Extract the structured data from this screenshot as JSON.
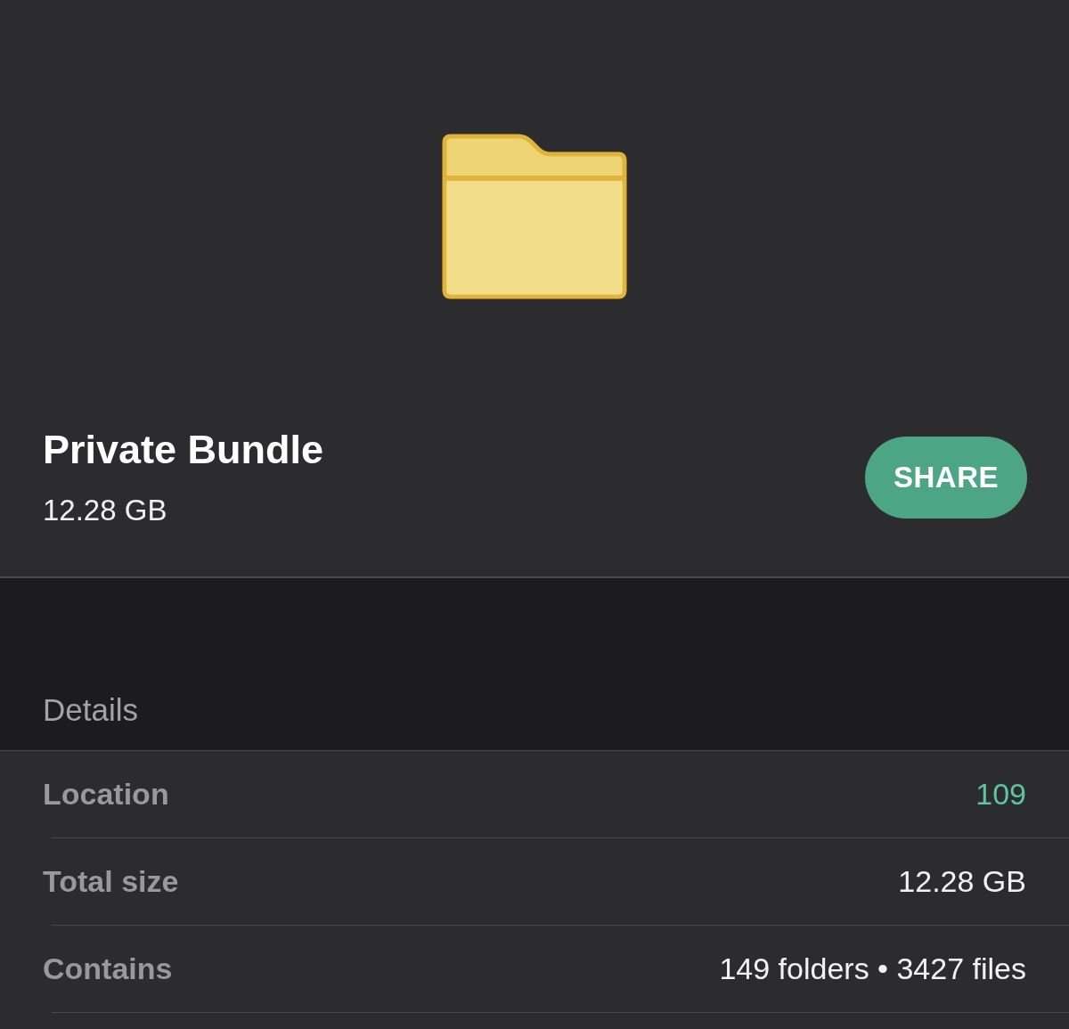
{
  "folder": {
    "name": "Private Bundle",
    "size": "12.28 GB"
  },
  "share_button": {
    "label": "SHARE"
  },
  "details": {
    "heading": "Details",
    "rows": [
      {
        "label": "Location",
        "value": "109",
        "kind": "link"
      },
      {
        "label": "Total size",
        "value": "12.28 GB",
        "kind": "text"
      },
      {
        "label": "Contains",
        "value": "149 folders • 3427 files",
        "kind": "text"
      }
    ]
  }
}
